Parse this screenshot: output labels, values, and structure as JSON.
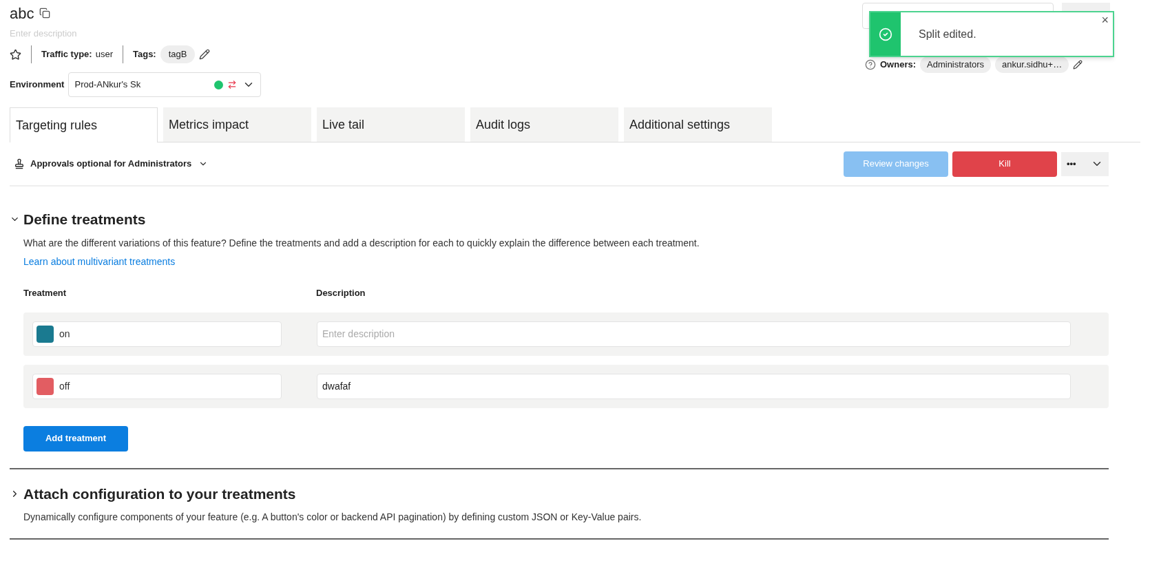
{
  "header": {
    "title": "abc",
    "description_placeholder": "Enter description",
    "traffic_type_label": "Traffic type:",
    "traffic_type": "user",
    "tags_label": "Tags:",
    "tags": [
      "tagB"
    ],
    "owners_label": "Owners:",
    "owners": [
      "Administrators",
      "ankur.sidhu+…"
    ]
  },
  "environment": {
    "label": "Environment",
    "value": "Prod-ANkur's Sk",
    "active": true
  },
  "tabs": [
    {
      "label": "Targeting rules",
      "selected": true
    },
    {
      "label": "Metrics impact",
      "selected": false
    },
    {
      "label": "Live tail",
      "selected": false
    },
    {
      "label": "Audit logs",
      "selected": false
    },
    {
      "label": "Additional settings",
      "selected": false
    }
  ],
  "toolbar": {
    "approvals": "Approvals optional for Administrators",
    "review_button": {
      "label": "Review changes",
      "disabled": true
    },
    "kill_button": "Kill",
    "more": "•••"
  },
  "sections": [
    {
      "title": "Define treatments",
      "expanded": true,
      "description": "What are the different variations of this feature? Define the treatments and add a description for each to quickly explain the difference between each treatment.",
      "link": "Learn about multivariant treatments",
      "columns": [
        "Treatment",
        "Description"
      ],
      "treatments": [
        {
          "name": "on",
          "color": "#1a7a90",
          "placeholder": "Enter description"
        },
        {
          "name": "off",
          "color": "#e25d62",
          "description": "dwafaf"
        }
      ],
      "add_button": "Add treatment"
    },
    {
      "title": "Attach configuration to your treatments",
      "expanded": false,
      "description": "Dynamically configure components of your feature (e.g. A button's color or backend API pagination) by defining custom JSON or Key-Value pairs."
    }
  ],
  "toast": {
    "message": "Split edited.",
    "close": "×"
  }
}
